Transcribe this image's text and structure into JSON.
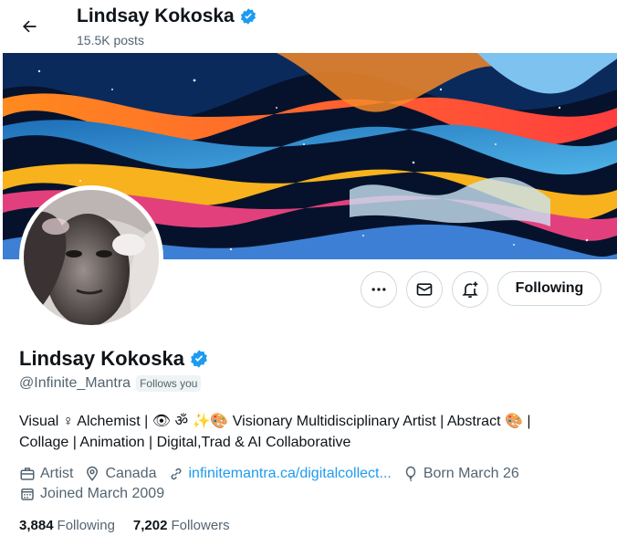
{
  "header": {
    "name": "Lindsay Kokoska",
    "posts": "15.5K posts"
  },
  "profile": {
    "name": "Lindsay Kokoska",
    "handle": "@Infinite_Mantra",
    "follows_you": "Follows you",
    "bio_line1": "Visual ♀ Alchemist | 👁 ॐ ✨🎨 Visionary Multidisciplinary Artist | Abstract 🎨 |",
    "bio_line2": "Collage | Animation | Digital,Trad & AI Collaborative",
    "category": "Artist",
    "location": "Canada",
    "website": "infinitemantra.ca/digitalcollect...",
    "born": "Born March 26",
    "joined": "Joined March 2009",
    "following_count": "3,884",
    "following_label": "Following",
    "followers_count": "7,202",
    "followers_label": "Followers"
  },
  "actions": {
    "follow_state": "Following"
  },
  "colors": {
    "accent": "#1d9bf0",
    "text": "#0f1419",
    "muted": "#536471"
  }
}
